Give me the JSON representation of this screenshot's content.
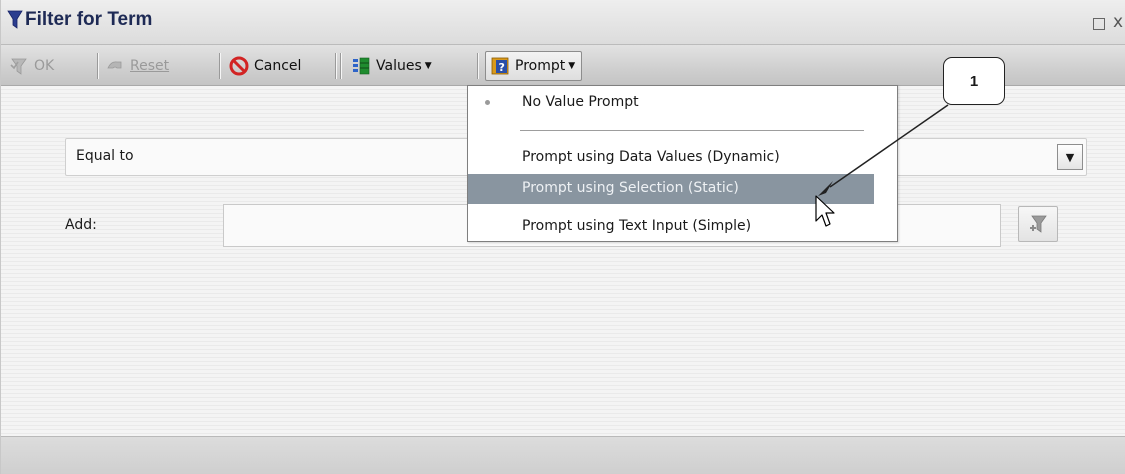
{
  "window": {
    "title": "Filter for Term",
    "maximize_glyph": "",
    "close_glyph": "x"
  },
  "toolbar": {
    "ok_label": "OK",
    "reset_label": "Reset",
    "cancel_label": "Cancel",
    "values_label": "Values",
    "prompt_label": "Prompt"
  },
  "filter": {
    "operator_value": "Equal to",
    "add_label": "Add:",
    "add_value": ""
  },
  "prompt_menu": {
    "items": [
      {
        "label": "No Value Prompt",
        "selected": true,
        "hovered": false
      },
      {
        "label": "Prompt using Data Values (Dynamic)",
        "selected": false,
        "hovered": false
      },
      {
        "label": "Prompt using Selection (Static)",
        "selected": false,
        "hovered": true
      },
      {
        "label": "Prompt using Text Input (Simple)",
        "selected": false,
        "hovered": false
      }
    ]
  },
  "annotation": {
    "callout_number": "1"
  },
  "icons": {
    "title": "funnel-icon",
    "ok": "funnel-check-icon",
    "reset": "reset-icon",
    "cancel": "cancel-icon",
    "values": "values-icon",
    "prompt": "prompt-icon",
    "add": "add-filter-icon",
    "cursor": "mouse-cursor-icon"
  },
  "colors": {
    "title_text": "#1e2a55",
    "funnel_blue": "#2b3d8f",
    "menu_hover": "#8995a0",
    "cancel_red": "#d22424"
  }
}
